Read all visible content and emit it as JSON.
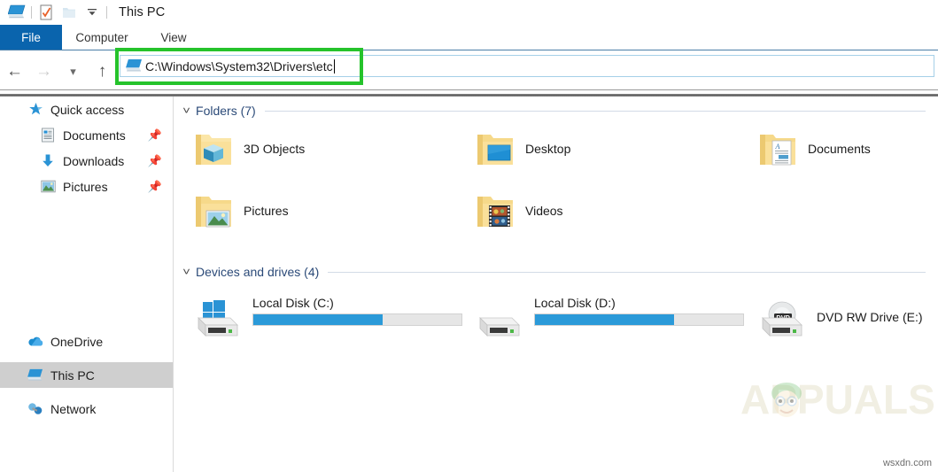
{
  "window": {
    "title": "This PC",
    "quick_access_toolbar": [
      {
        "name": "this-pc-icon",
        "label": "This PC"
      },
      {
        "name": "properties-icon",
        "label": "Properties"
      },
      {
        "name": "new-folder-icon",
        "label": "New folder"
      },
      {
        "name": "customize-quick-access-toolbar-icon",
        "label": "Customize Quick Access Toolbar"
      }
    ]
  },
  "ribbon": {
    "tabs": [
      {
        "label": "File",
        "active": true
      },
      {
        "label": "Computer",
        "active": false
      },
      {
        "label": "View",
        "active": false
      }
    ]
  },
  "navigation": {
    "back_label": "Back",
    "forward_label": "Forward",
    "recent_label": "Recent locations",
    "up_label": "Up",
    "address": {
      "value": "C:\\Windows\\System32\\Drivers\\etc",
      "placeholder": "",
      "icon": "this-pc-icon",
      "focused": true
    },
    "annotation": {
      "color": "#25c32b",
      "shape": "rectangle"
    }
  },
  "sidebar": {
    "items": [
      {
        "label": "Quick access",
        "icon": "star-pin-icon",
        "level": "root",
        "pinned": false,
        "selected": false
      },
      {
        "label": "Documents",
        "icon": "documents-icon",
        "level": "child",
        "pinned": true,
        "selected": false
      },
      {
        "label": "Downloads",
        "icon": "downloads-arrow-icon",
        "level": "child",
        "pinned": true,
        "selected": false
      },
      {
        "label": "Pictures",
        "icon": "pictures-icon",
        "level": "child",
        "pinned": true,
        "selected": false
      },
      {
        "label": "OneDrive",
        "icon": "onedrive-cloud-icon",
        "level": "root",
        "pinned": false,
        "selected": false
      },
      {
        "label": "This PC",
        "icon": "this-pc-icon",
        "level": "root",
        "pinned": false,
        "selected": true
      },
      {
        "label": "Network",
        "icon": "network-icon",
        "level": "root",
        "pinned": false,
        "selected": false
      }
    ]
  },
  "main": {
    "groups": [
      {
        "title": "Folders (7)",
        "expanded": true,
        "items": [
          {
            "label": "3D Objects",
            "icon": "folder-3d-objects-icon"
          },
          {
            "label": "Desktop",
            "icon": "folder-desktop-icon"
          },
          {
            "label": "Documents",
            "icon": "folder-documents-icon"
          },
          {
            "label": "Pictures",
            "icon": "folder-pictures-icon"
          },
          {
            "label": "Videos",
            "icon": "folder-videos-icon"
          }
        ]
      },
      {
        "title": "Devices and drives (4)",
        "expanded": true,
        "items": [
          {
            "label": "Local Disk (C:)",
            "icon": "windows-drive-icon",
            "used_percent": 62
          },
          {
            "label": "Local Disk (D:)",
            "icon": "hard-drive-icon",
            "used_percent": 67
          },
          {
            "label": "DVD RW Drive (E:)",
            "icon": "dvd-drive-icon",
            "used_percent": null
          }
        ]
      }
    ]
  },
  "watermarks": {
    "brand": "APPUALS",
    "source": "wsxdn.com"
  },
  "colors": {
    "accent_blue": "#0a64ad",
    "bar_fill": "#2b9ad9",
    "bar_track": "#e6e6e6",
    "annotation_green": "#25c32b",
    "group_title": "#2b4a78",
    "selection_gray": "#cfcfcf"
  }
}
